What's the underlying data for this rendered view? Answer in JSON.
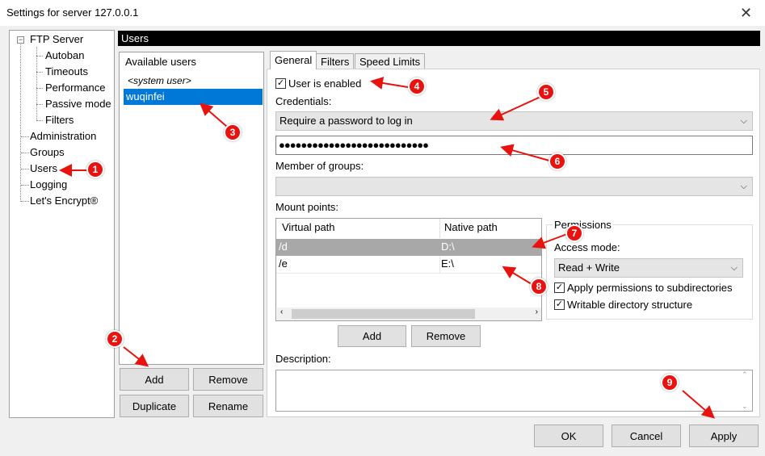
{
  "window": {
    "title": "Settings for server 127.0.0.1",
    "background_text": ""
  },
  "tree": {
    "root": "FTP Server",
    "children": [
      "Autoban",
      "Timeouts",
      "Performance",
      "Passive mode",
      "Filters"
    ],
    "items": [
      "Administration",
      "Groups",
      "Users",
      "Logging",
      "Let's Encrypt®"
    ]
  },
  "header": {
    "title": "Users"
  },
  "users": {
    "title": "Available users",
    "system_user": "<system user>",
    "selected_user": "wuqinfei",
    "add_label": "Add",
    "remove_label": "Remove",
    "duplicate_label": "Duplicate",
    "rename_label": "Rename"
  },
  "tabs": {
    "general": "General",
    "filters": "Filters",
    "speed": "Speed Limits"
  },
  "general": {
    "user_enabled_label": "User is enabled",
    "user_enabled_checked": true,
    "credentials_label": "Credentials:",
    "credentials_value": "Require a password to log in",
    "password_value": "●●●●●●●●●●●●●●●●●●●●●●●●●●●",
    "groups_label": "Member of groups:",
    "groups_value": "",
    "mount_label": "Mount points:",
    "mount_columns": [
      "Virtual path",
      "Native path"
    ],
    "mount_rows": [
      {
        "virtual": "/d",
        "native": "D:\\"
      },
      {
        "virtual": "/e",
        "native": "E:\\"
      }
    ],
    "mount_add_label": "Add",
    "mount_remove_label": "Remove",
    "description_label": "Description:",
    "description_value": ""
  },
  "permissions": {
    "legend": "Permissions",
    "access_mode_label": "Access mode:",
    "access_mode_value": "Read + Write",
    "apply_subdirs_label": "Apply permissions to subdirectories",
    "apply_subdirs_checked": true,
    "writable_label": "Writable directory structure",
    "writable_checked": true
  },
  "footer": {
    "ok_label": "OK",
    "cancel_label": "Cancel",
    "apply_label": "Apply"
  },
  "annotations": [
    "1",
    "2",
    "3",
    "4",
    "5",
    "6",
    "7",
    "8",
    "9"
  ],
  "colors": {
    "selection": "#0078d7",
    "annotation": "#e8130f",
    "header_bg": "#000000"
  },
  "icons": {
    "close": "close-icon",
    "tree_toggle": "minus-icon",
    "dropdown": "chevron-down-icon"
  }
}
